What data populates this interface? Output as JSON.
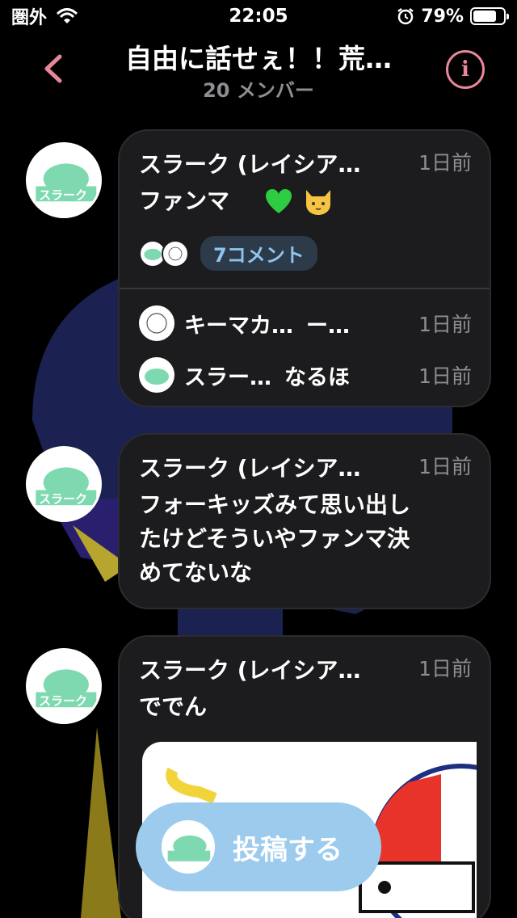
{
  "status": {
    "carrier": "圏外",
    "time": "22:05",
    "battery": "79%",
    "battery_level": 0.79
  },
  "header": {
    "title": "自由に話せぇ！！荒…",
    "subtitle": "20 メンバー"
  },
  "messages": [
    {
      "author": "スラーク (レイシア…",
      "time": "1日前",
      "text": "ファンマ",
      "comments_label": "7コメント",
      "replies": [
        {
          "name": "キーマカ…",
          "text": "ー…",
          "time": "1日前"
        },
        {
          "name": "スラー…",
          "text": "なるほ",
          "time": "1日前"
        }
      ]
    },
    {
      "author": "スラーク (レイシア…",
      "time": "1日前",
      "lines": [
        "フォーキッズみて思い出し",
        "たけどそういやファンマ決",
        "めてないな"
      ]
    },
    {
      "author": "スラーク (レイシア…",
      "time": "1日前",
      "text": "ででん"
    }
  ],
  "avatar_text": "スラーク",
  "post_button": {
    "label": "投稿する"
  },
  "colors": {
    "accent": "#e8869a",
    "bubble": "#1c1c1e",
    "post_button": "#9ccbee",
    "comment_pill_text": "#8ec5ee"
  },
  "icons": [
    "wifi-icon",
    "alarm-icon",
    "back-chevron-icon",
    "info-icon",
    "green-heart-emoji",
    "cat-emoji"
  ]
}
